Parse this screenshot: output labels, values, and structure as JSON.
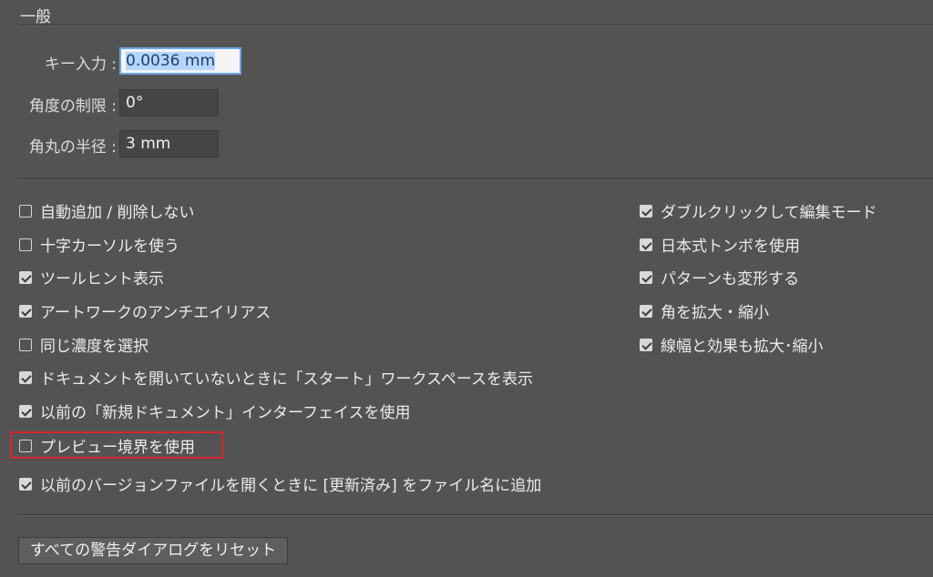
{
  "section_title": "一般",
  "fields": {
    "keyboard_increment": {
      "label": "キー入力 :",
      "value": "0.0036 mm"
    },
    "constrain_angle": {
      "label": "角度の制限 :",
      "value": "0°"
    },
    "corner_radius": {
      "label": "角丸の半径 :",
      "value": "3 mm"
    }
  },
  "options_left": [
    {
      "label": "自動追加 / 削除しない",
      "checked": false
    },
    {
      "label": "十字カーソルを使う",
      "checked": false
    },
    {
      "label": "ツールヒント表示",
      "checked": true
    },
    {
      "label": "アートワークのアンチエイリアス",
      "checked": true
    },
    {
      "label": "同じ濃度を選択",
      "checked": false
    },
    {
      "label": "ドキュメントを開いていないときに「スタート」ワークスペースを表示",
      "checked": true
    },
    {
      "label": "以前の「新規ドキュメント」インターフェイスを使用",
      "checked": true
    },
    {
      "label": "プレビュー境界を使用",
      "checked": false
    },
    {
      "label": "以前のバージョンファイルを開くときに [更新済み] をファイル名に追加",
      "checked": true
    }
  ],
  "options_right": [
    {
      "label": "ダブルクリックして編集モード",
      "checked": true
    },
    {
      "label": "日本式トンボを使用",
      "checked": true
    },
    {
      "label": "パターンも変形する",
      "checked": true
    },
    {
      "label": "角を拡大・縮小",
      "checked": true
    },
    {
      "label": "線幅と効果も拡大･縮小",
      "checked": true
    }
  ],
  "reset_button_label": "すべての警告ダイアログをリセット",
  "highlight_color": "#d7262b"
}
